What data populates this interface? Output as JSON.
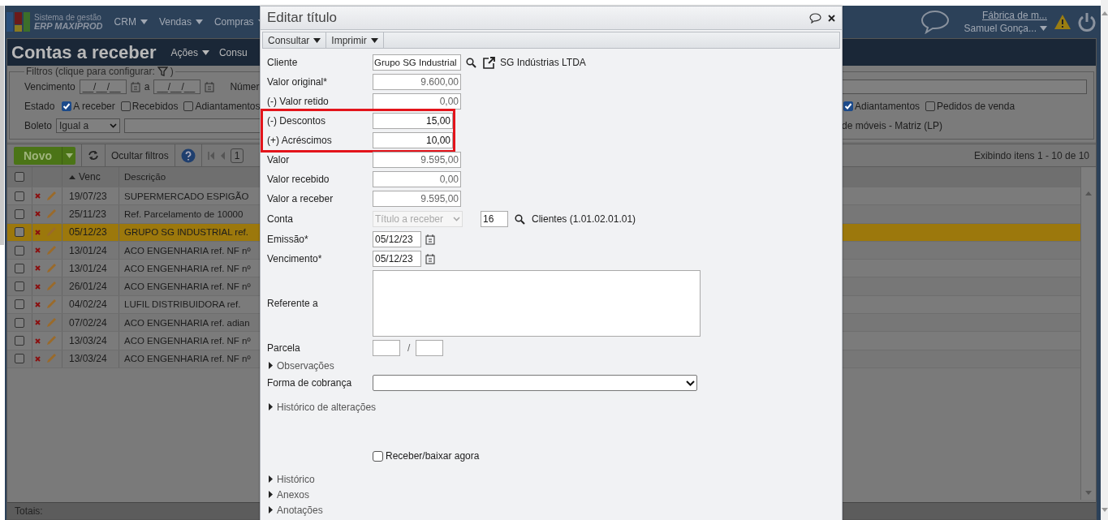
{
  "header": {
    "logo_line1": "Sistema de gestão",
    "logo_line2": "ERP MAXIPROD",
    "menus": [
      "CRM",
      "Vendas",
      "Compras"
    ],
    "company": "Fábrica de m...",
    "user": "Samuel Gonça..."
  },
  "page": {
    "title": "Contas a receber",
    "actions": [
      "Ações",
      "Consu"
    ]
  },
  "filters": {
    "legend": "Filtros (clique para configurar:",
    "legend_end": ")",
    "vencimento_label": "Vencimento",
    "date_from": "__/__/__",
    "between": "a",
    "date_to": "__/__/__",
    "numero_label": "Númer",
    "estado_label": "Estado",
    "estado_options": [
      {
        "label": "A receber",
        "checked": true
      },
      {
        "label": "Recebidos",
        "checked": false
      },
      {
        "label": "Adiantamentos",
        "checked": false
      }
    ],
    "estado_options_right": [
      {
        "label": "Adiantamentos",
        "checked": true
      },
      {
        "label": "Pedidos de venda",
        "checked": false
      }
    ],
    "boleto_label": "Boleto",
    "boleto_operator": "Igual a",
    "empresa_text": "de móveis - Matriz (LP)"
  },
  "toolbar": {
    "new": "Novo",
    "hide_filters": "Ocultar filtros",
    "page": "1",
    "summary": "Exibindo itens 1 - 10 de 10"
  },
  "table": {
    "columns": [
      "Venc",
      "Descrição"
    ],
    "header_checked": false,
    "rows": [
      {
        "venc": "19/07/23",
        "descricao": "SUPERMERCADO ESPIGÃO",
        "checked": false,
        "selected": false
      },
      {
        "venc": "25/11/23",
        "descricao": "Ref. Parcelamento de 10000",
        "checked": false,
        "selected": false
      },
      {
        "venc": "05/12/23",
        "descricao": "GRUPO SG INDUSTRIAL ref.",
        "checked": false,
        "selected": true
      },
      {
        "venc": "13/01/24",
        "descricao": "ACO ENGENHARIA ref. NF nº",
        "checked": false,
        "selected": false
      },
      {
        "venc": "13/01/24",
        "descricao": "ACO ENGENHARIA ref. NF nº",
        "checked": false,
        "selected": false
      },
      {
        "venc": "26/01/24",
        "descricao": "ACO ENGENHARIA ref. NF nº",
        "checked": false,
        "selected": false
      },
      {
        "venc": "04/02/24",
        "descricao": "LUFIL DISTRIBUIDORA ref.",
        "checked": false,
        "selected": false
      },
      {
        "venc": "07/02/24",
        "descricao": "ACO ENGENHARIA ref. adian",
        "checked": false,
        "selected": false
      },
      {
        "venc": "13/03/24",
        "descricao": "ACO ENGENHARIA ref. NF nº",
        "checked": false,
        "selected": false
      },
      {
        "venc": "13/03/24",
        "descricao": "ACO ENGENHARIA ref. NF nº",
        "checked": false,
        "selected": false
      }
    ],
    "footer": "Totais:"
  },
  "dialog": {
    "title": "Editar título",
    "menus": [
      "Consultar",
      "Imprimir"
    ],
    "fields": [
      {
        "kind": "lookup",
        "label": "Cliente",
        "value": "Grupo SG Industrial",
        "link": "SG Indústrias LTDA"
      },
      {
        "kind": "amount",
        "label": "Valor original*",
        "value": "9.600,00",
        "readonly": true,
        "highlighted": false
      },
      {
        "kind": "amount",
        "label": "(-) Valor retido",
        "value": "0,00",
        "readonly": true,
        "highlighted": false
      },
      {
        "kind": "amount",
        "label": "(-) Descontos",
        "value": "15,00",
        "readonly": false,
        "highlighted": true
      },
      {
        "kind": "amount",
        "label": "(+) Acréscimos",
        "value": "10,00",
        "readonly": false,
        "highlighted": true
      },
      {
        "kind": "amount",
        "label": "Valor",
        "value": "9.595,00",
        "readonly": true,
        "highlighted": false
      },
      {
        "kind": "amount",
        "label": "Valor recebido",
        "value": "0,00",
        "readonly": true,
        "highlighted": false
      },
      {
        "kind": "amount",
        "label": "Valor a receber",
        "value": "9.595,00",
        "readonly": true,
        "highlighted": false
      },
      {
        "kind": "account",
        "label": "Conta",
        "select": "Título a receber",
        "disabled": true,
        "code": "16",
        "account": "Clientes (1.01.02.01.01)"
      },
      {
        "kind": "date",
        "label": "Emissão*",
        "value": "05/12/23"
      },
      {
        "kind": "date",
        "label": "Vencimento*",
        "value": "05/12/23"
      },
      {
        "kind": "textarea",
        "label": "Referente a"
      },
      {
        "kind": "parcela",
        "label": "Parcela",
        "separator": "/"
      },
      {
        "kind": "section",
        "label": "Observações",
        "expanded": false
      },
      {
        "kind": "select",
        "label": "Forma de cobrança"
      },
      {
        "kind": "section",
        "label": "Histórico de alterações",
        "expanded": false
      },
      {
        "kind": "checkbox",
        "label": "Receber/baixar agora",
        "checked": false
      },
      {
        "kind": "section",
        "label": "Histórico",
        "expanded": false
      },
      {
        "kind": "section",
        "label": "Anexos",
        "expanded": false
      },
      {
        "kind": "section",
        "label": "Anotações",
        "expanded": false
      }
    ]
  }
}
